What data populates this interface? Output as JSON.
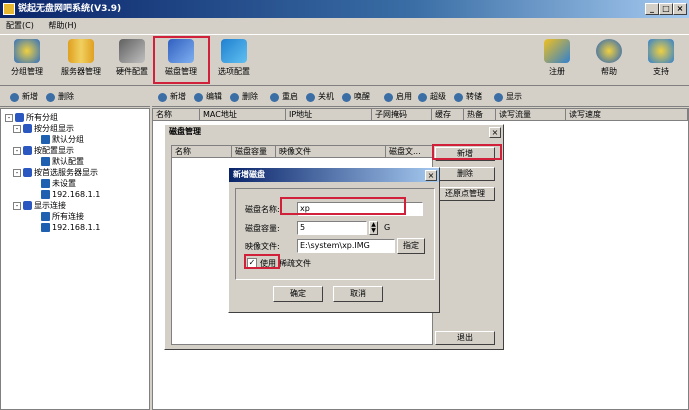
{
  "window": {
    "title": "锐起无盘网吧系统(V3.9)"
  },
  "menu": [
    "配置(C)",
    "帮助(H)"
  ],
  "toolbar": {
    "left": [
      "分组管理",
      "服务器管理",
      "硬件配置",
      "磁盘管理",
      "选项配置"
    ],
    "right": [
      "注册",
      "帮助",
      "支持"
    ]
  },
  "left_actions": [
    "新增",
    "删除"
  ],
  "right_actions": [
    "新增",
    "编辑",
    "删除",
    "重启",
    "关机",
    "唤醒",
    "启用",
    "超级",
    "转储",
    "显示"
  ],
  "table_headers": [
    "名称",
    "MAC地址",
    "IP地址",
    "子网掩码",
    "缓存",
    "热备",
    "读写流量",
    "读写速度"
  ],
  "tree": {
    "root": "所有分组",
    "nodes": [
      {
        "label": "按分组显示",
        "children": [
          "默认分组"
        ]
      },
      {
        "label": "按配置显示",
        "children": [
          "默认配置"
        ]
      },
      {
        "label": "按首选服务器显示",
        "children": [
          "未设置",
          "192.168.1.1"
        ]
      },
      {
        "label": "显示连接",
        "children": [
          "所有连接",
          "192.168.1.1"
        ]
      }
    ]
  },
  "disk_dialog": {
    "title": "磁盘管理",
    "headers": [
      "名称",
      "磁盘容量",
      "映像文件",
      "磁盘文..."
    ],
    "buttons": [
      "新增",
      "删除",
      "还原点管理",
      "退出"
    ]
  },
  "new_disk": {
    "title": "新增磁盘",
    "name_label": "磁盘名称:",
    "name_value": "xp",
    "size_label": "磁盘容量:",
    "size_value": "5",
    "size_unit": "G",
    "image_label": "映像文件:",
    "image_value": "E:\\system\\xp.IMG",
    "browse": "指定",
    "checkbox_label": "使用",
    "checkbox_label2": "稀疏文件",
    "checked": true,
    "ok": "确定",
    "cancel": "取消"
  },
  "colors": {
    "title": "#0a246a",
    "highlight": "#d0203a"
  }
}
